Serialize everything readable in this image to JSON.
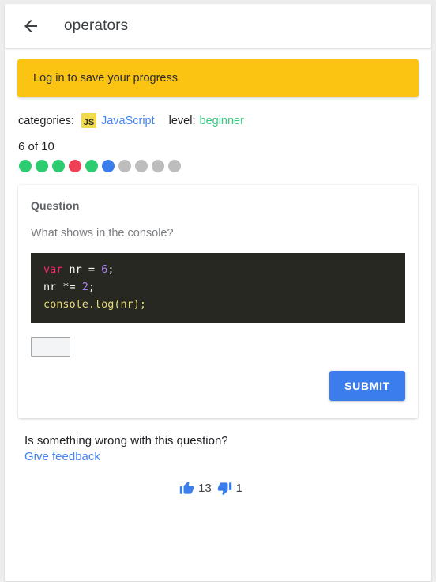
{
  "appbar": {
    "back_icon": "arrow-left-icon",
    "title": "operators"
  },
  "login_banner": {
    "label": "Log in to save your progress",
    "color": "#fbc412"
  },
  "meta": {
    "categories_label": "categories:",
    "category_badge": "JS",
    "category_name": "JavaScript",
    "category_color": "#4285f4",
    "badge_color": "#f0db4f",
    "level_label": "level:",
    "level_value": "beginner",
    "level_color": "#34c97e"
  },
  "progress": {
    "count_text": "6 of 10",
    "total": 10,
    "current_index": 6,
    "dots": [
      "correct",
      "correct",
      "correct",
      "wrong",
      "correct",
      "current",
      "pending",
      "pending",
      "pending",
      "pending"
    ],
    "colors": {
      "correct": "#2ecc71",
      "wrong": "#ef4056",
      "current": "#3b7ded",
      "pending": "#bdbdbd"
    }
  },
  "question_card": {
    "heading": "Question",
    "prompt": "What shows in the console?",
    "code": {
      "language": "javascript",
      "background": "#272822",
      "lines": [
        [
          {
            "t": "var",
            "c": "kw"
          },
          {
            "t": " ",
            "c": "pun"
          },
          {
            "t": "nr",
            "c": "var"
          },
          {
            "t": " = ",
            "c": "pun"
          },
          {
            "t": "6",
            "c": "num"
          },
          {
            "t": ";",
            "c": "pun"
          }
        ],
        [
          {
            "t": "nr",
            "c": "var"
          },
          {
            "t": " *= ",
            "c": "pun"
          },
          {
            "t": "2",
            "c": "num"
          },
          {
            "t": ";",
            "c": "pun"
          }
        ],
        [
          {
            "t": "console.log(nr);",
            "c": "fn"
          }
        ]
      ],
      "plain_text": "var nr = 6;\nnr *= 2;\nconsole.log(nr);"
    },
    "answer_value": "",
    "answer_placeholder": "",
    "submit_label": "SUBMIT",
    "submit_color": "#3b7ded"
  },
  "feedback": {
    "question": "Is something wrong with this question?",
    "link_label": "Give feedback",
    "link_color": "#4285f4",
    "thumbs_up_icon": "thumbs-up-icon",
    "thumbs_up_count": "13",
    "thumbs_down_icon": "thumbs-down-icon",
    "thumbs_down_count": "1",
    "vote_icon_color": "#3b7ded"
  }
}
